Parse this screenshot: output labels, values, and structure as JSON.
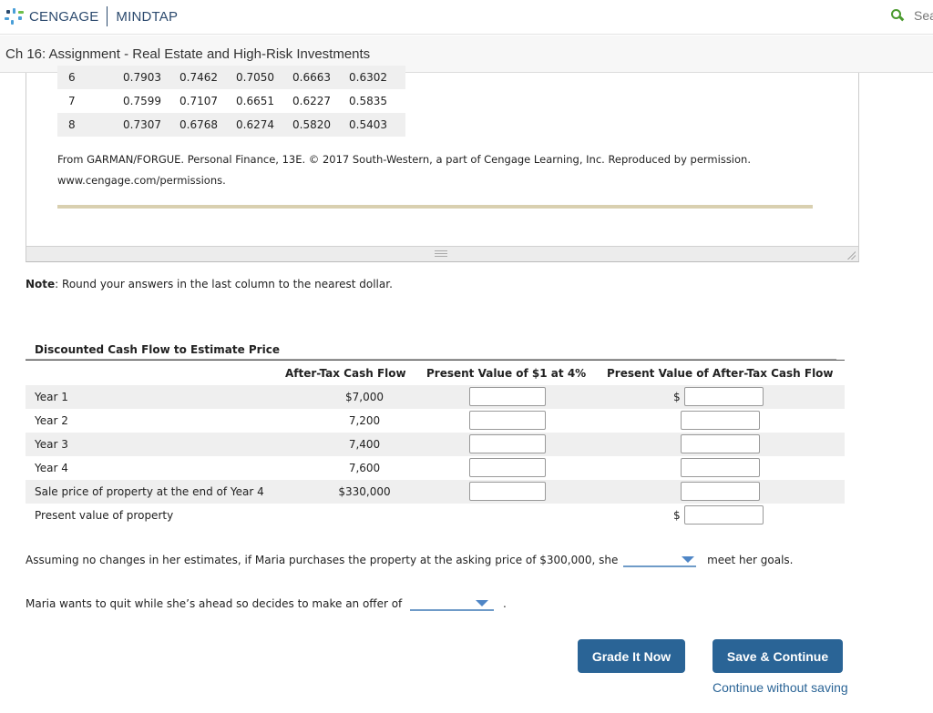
{
  "header": {
    "brand": "CENGAGE",
    "product": "MINDTAP",
    "search_label": "Sea",
    "brand_color": "#2c4a6e",
    "search_icon_color": "#4a9a2e"
  },
  "subheader": {
    "title": "Ch 16: Assignment - Real Estate and High-Risk Investments"
  },
  "pv_table": {
    "rows": [
      {
        "period": "6",
        "values": [
          "0.7903",
          "0.7462",
          "0.7050",
          "0.6663",
          "0.6302"
        ]
      },
      {
        "period": "7",
        "values": [
          "0.7599",
          "0.7107",
          "0.6651",
          "0.6227",
          "0.5835"
        ]
      },
      {
        "period": "8",
        "values": [
          "0.7307",
          "0.6768",
          "0.6274",
          "0.5820",
          "0.5403"
        ]
      }
    ]
  },
  "credit": {
    "line1": "From GARMAN/FORGUE. Personal Finance, 13E. © 2017 South-Western, a part of Cengage Learning, Inc. Reproduced by permission.",
    "line2": "www.cengage.com/permissions."
  },
  "note": {
    "bold": "Note",
    "text": ": Round your answers in the last column to the nearest dollar."
  },
  "dcf": {
    "title": "Discounted Cash Flow to Estimate Price",
    "columns": [
      "After-Tax Cash Flow",
      "Present Value of $1 at 4%",
      "Present Value of After-Tax Cash Flow"
    ],
    "currency_symbol": "$",
    "rows": [
      {
        "label": "Year 1",
        "cash_flow": "$7,000",
        "pv_factor": "",
        "pv_cash_flow": ""
      },
      {
        "label": "Year 2",
        "cash_flow": "7,200",
        "pv_factor": "",
        "pv_cash_flow": ""
      },
      {
        "label": "Year 3",
        "cash_flow": "7,400",
        "pv_factor": "",
        "pv_cash_flow": ""
      },
      {
        "label": "Year 4",
        "cash_flow": "7,600",
        "pv_factor": "",
        "pv_cash_flow": ""
      },
      {
        "label": "Sale price of property at the end of Year 4",
        "cash_flow": "$330,000",
        "pv_factor": "",
        "pv_cash_flow": ""
      },
      {
        "label": "Present value of property",
        "pv_cash_flow": ""
      }
    ]
  },
  "question1": {
    "before": "Assuming no changes in her estimates, if Maria purchases the property at the asking price of $300,000, she",
    "selected": "",
    "after": "meet her goals."
  },
  "question2": {
    "before": "Maria wants to quit while she’s ahead so decides to make an offer of",
    "selected": "",
    "after": "."
  },
  "actions": {
    "grade_label": "Grade It Now",
    "save_label": "Save & Continue",
    "continue_label": "Continue without saving",
    "button_color": "#2a6496"
  }
}
